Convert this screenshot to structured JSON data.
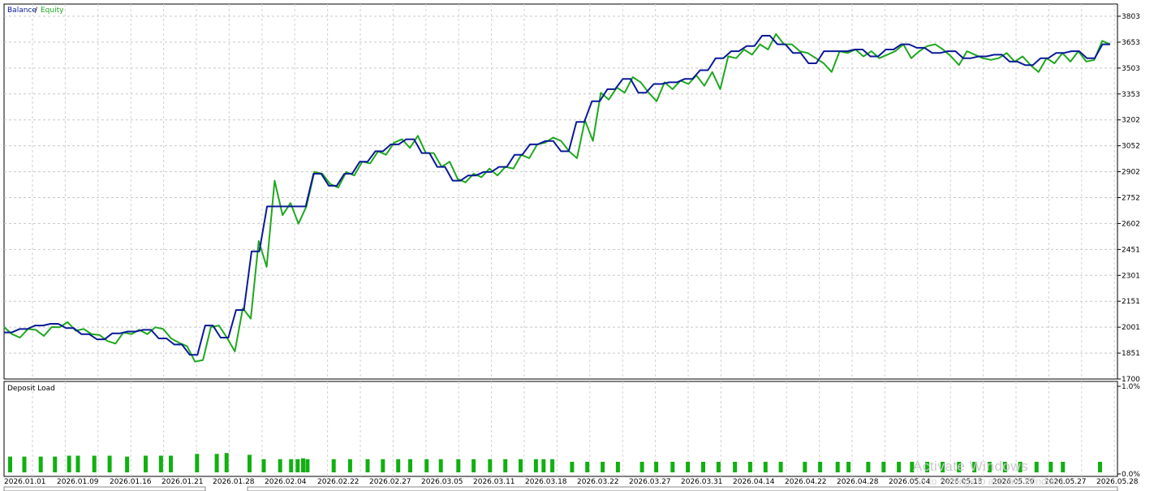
{
  "chart_data": [
    {
      "type": "line",
      "legend": [
        "Balance",
        "/",
        "Equity"
      ],
      "colors": {
        "balance": "#0a1a96",
        "equity": "#1fa81f",
        "separator": "#000000"
      },
      "y_ticks": [
        "3803",
        "3653",
        "3503",
        "3353",
        "3202",
        "3052",
        "2902",
        "2752",
        "2602",
        "2451",
        "2301",
        "2151",
        "2001",
        "1851",
        "1700"
      ],
      "ylim": [
        1700,
        3803
      ],
      "x_ticks": [
        "2026.01.01",
        "2026.01.09",
        "2026.01.16",
        "2026.01.21",
        "2026.01.28",
        "2026.02.04",
        "2026.02.22",
        "2026.02.27",
        "2026.03.05",
        "2026.03.11",
        "2026.03.18",
        "2026.03.22",
        "2026.03.27",
        "2026.03.31",
        "2026.04.14",
        "2026.04.22",
        "2026.04.28",
        "2026.05.04",
        "2026.05.13",
        "2026.05.20",
        "2026.05.27",
        "2026.05.28"
      ],
      "grid": true,
      "series": [
        {
          "name": "Balance",
          "values": [
            1970,
            1970,
            1990,
            1990,
            2010,
            2010,
            2020,
            2020,
            1995,
            1995,
            1960,
            1960,
            1930,
            1930,
            1965,
            1965,
            1975,
            1975,
            1985,
            1985,
            1935,
            1935,
            1900,
            1900,
            1840,
            1840,
            2010,
            2010,
            1940,
            1940,
            2100,
            2100,
            2440,
            2440,
            2700,
            2700,
            2700,
            2700,
            2700,
            2700,
            2890,
            2890,
            2820,
            2820,
            2890,
            2890,
            2960,
            2960,
            3020,
            3020,
            3060,
            3060,
            3090,
            3090,
            3010,
            3010,
            2930,
            2930,
            2850,
            2850,
            2880,
            2880,
            2900,
            2900,
            2930,
            2930,
            3000,
            3000,
            3060,
            3060,
            3080,
            3080,
            3020,
            3020,
            3190,
            3190,
            3310,
            3310,
            3380,
            3380,
            3440,
            3440,
            3360,
            3360,
            3410,
            3410,
            3420,
            3420,
            3440,
            3440,
            3490,
            3490,
            3560,
            3560,
            3600,
            3600,
            3630,
            3630,
            3690,
            3690,
            3640,
            3640,
            3590,
            3590,
            3530,
            3530,
            3600,
            3600,
            3600,
            3600,
            3610,
            3610,
            3570,
            3570,
            3610,
            3610,
            3640,
            3640,
            3620,
            3620,
            3590,
            3590,
            3600,
            3600,
            3560,
            3560,
            3570,
            3570,
            3580,
            3580,
            3540,
            3540,
            3520,
            3520,
            3560,
            3560,
            3590,
            3590,
            3600,
            3600,
            3560,
            3560,
            3640,
            3640
          ]
        },
        {
          "name": "Equity",
          "values": [
            2001,
            1960,
            1940,
            1990,
            1985,
            1950,
            2001,
            2000,
            2030,
            1980,
            1990,
            1960,
            1955,
            1920,
            1905,
            1970,
            1960,
            1985,
            1960,
            2000,
            1990,
            1935,
            1910,
            1890,
            1800,
            1810,
            2001,
            2010,
            1940,
            1860,
            2110,
            2050,
            2500,
            2350,
            2850,
            2650,
            2720,
            2600,
            2701,
            2900,
            2890,
            2830,
            2810,
            2900,
            2880,
            2960,
            2950,
            3020,
            3000,
            3070,
            3090,
            3040,
            3110,
            3010,
            3010,
            2930,
            2960,
            2860,
            2840,
            2890,
            2870,
            2920,
            2880,
            2930,
            2920,
            3000,
            2980,
            3060,
            3070,
            3100,
            3080,
            3020,
            2980,
            3200,
            3080,
            3360,
            3320,
            3390,
            3360,
            3450,
            3420,
            3360,
            3310,
            3420,
            3380,
            3430,
            3410,
            3460,
            3400,
            3480,
            3380,
            3570,
            3560,
            3610,
            3580,
            3640,
            3610,
            3700,
            3640,
            3640,
            3600,
            3590,
            3560,
            3530,
            3480,
            3600,
            3590,
            3610,
            3570,
            3600,
            3560,
            3580,
            3600,
            3640,
            3560,
            3600,
            3630,
            3640,
            3610,
            3570,
            3520,
            3600,
            3580,
            3560,
            3550,
            3560,
            3590,
            3540,
            3570,
            3520,
            3480,
            3560,
            3530,
            3590,
            3540,
            3600,
            3540,
            3550,
            3660,
            3640
          ]
        }
      ]
    },
    {
      "type": "bar",
      "label": "Deposit Load",
      "y_ticks": [
        "1.0%",
        "0.0%"
      ],
      "ylim": [
        0,
        1.0
      ],
      "color": "#11b011",
      "bars": [
        {
          "x": "2026.01.01",
          "pos": 0.0,
          "value": 0.18
        },
        {
          "x": "",
          "pos": 0.013,
          "value": 0.18
        },
        {
          "x": "",
          "pos": 0.028,
          "value": 0.18
        },
        {
          "x": "",
          "pos": 0.041,
          "value": 0.18
        },
        {
          "x": "2026.01.09",
          "pos": 0.054,
          "value": 0.19
        },
        {
          "x": "",
          "pos": 0.062,
          "value": 0.19
        },
        {
          "x": "",
          "pos": 0.077,
          "value": 0.19
        },
        {
          "x": "",
          "pos": 0.091,
          "value": 0.19
        },
        {
          "x": "2026.01.16",
          "pos": 0.107,
          "value": 0.18
        },
        {
          "x": "",
          "pos": 0.124,
          "value": 0.19
        },
        {
          "x": "",
          "pos": 0.138,
          "value": 0.19
        },
        {
          "x": "",
          "pos": 0.147,
          "value": 0.19
        },
        {
          "x": "2026.01.21",
          "pos": 0.171,
          "value": 0.21
        },
        {
          "x": "",
          "pos": 0.189,
          "value": 0.21
        },
        {
          "x": "",
          "pos": 0.198,
          "value": 0.22
        },
        {
          "x": "2026.01.28",
          "pos": 0.219,
          "value": 0.2
        },
        {
          "x": "",
          "pos": 0.232,
          "value": 0.15
        },
        {
          "x": "",
          "pos": 0.247,
          "value": 0.15
        },
        {
          "x": "",
          "pos": 0.257,
          "value": 0.15
        },
        {
          "x": "2026.02.04",
          "pos": 0.263,
          "value": 0.15
        },
        {
          "x": "",
          "pos": 0.268,
          "value": 0.16
        },
        {
          "x": "",
          "pos": 0.272,
          "value": 0.15
        },
        {
          "x": "2026.02.22",
          "pos": 0.296,
          "value": 0.15
        },
        {
          "x": "",
          "pos": 0.311,
          "value": 0.15
        },
        {
          "x": "",
          "pos": 0.327,
          "value": 0.15
        },
        {
          "x": "",
          "pos": 0.341,
          "value": 0.15
        },
        {
          "x": "2026.02.27",
          "pos": 0.355,
          "value": 0.15
        },
        {
          "x": "",
          "pos": 0.366,
          "value": 0.15
        },
        {
          "x": "",
          "pos": 0.381,
          "value": 0.15
        },
        {
          "x": "2026.03.05",
          "pos": 0.394,
          "value": 0.15
        },
        {
          "x": "",
          "pos": 0.41,
          "value": 0.15
        },
        {
          "x": "",
          "pos": 0.424,
          "value": 0.15
        },
        {
          "x": "2026.03.11",
          "pos": 0.439,
          "value": 0.15
        },
        {
          "x": "",
          "pos": 0.453,
          "value": 0.15
        },
        {
          "x": "",
          "pos": 0.467,
          "value": 0.15
        },
        {
          "x": "2026.03.18",
          "pos": 0.481,
          "value": 0.15
        },
        {
          "x": "",
          "pos": 0.488,
          "value": 0.15
        },
        {
          "x": "",
          "pos": 0.496,
          "value": 0.15
        },
        {
          "x": "2026.03.22",
          "pos": 0.514,
          "value": 0.12
        },
        {
          "x": "",
          "pos": 0.528,
          "value": 0.12
        },
        {
          "x": "",
          "pos": 0.542,
          "value": 0.12
        },
        {
          "x": "",
          "pos": 0.556,
          "value": 0.12
        },
        {
          "x": "2026.03.27",
          "pos": 0.578,
          "value": 0.12
        },
        {
          "x": "",
          "pos": 0.591,
          "value": 0.12
        },
        {
          "x": "",
          "pos": 0.606,
          "value": 0.12
        },
        {
          "x": "2026.03.31",
          "pos": 0.62,
          "value": 0.12
        },
        {
          "x": "",
          "pos": 0.634,
          "value": 0.12
        },
        {
          "x": "",
          "pos": 0.648,
          "value": 0.12
        },
        {
          "x": "2026.04.14",
          "pos": 0.663,
          "value": 0.12
        },
        {
          "x": "",
          "pos": 0.677,
          "value": 0.12
        },
        {
          "x": "",
          "pos": 0.691,
          "value": 0.12
        },
        {
          "x": "",
          "pos": 0.705,
          "value": 0.12
        },
        {
          "x": "2026.04.22",
          "pos": 0.727,
          "value": 0.12
        },
        {
          "x": "",
          "pos": 0.741,
          "value": 0.12
        },
        {
          "x": "",
          "pos": 0.757,
          "value": 0.12
        },
        {
          "x": "2026.04.28",
          "pos": 0.767,
          "value": 0.12
        },
        {
          "x": "",
          "pos": 0.785,
          "value": 0.12
        },
        {
          "x": "",
          "pos": 0.799,
          "value": 0.12
        },
        {
          "x": "2026.05.04",
          "pos": 0.813,
          "value": 0.12
        },
        {
          "x": "",
          "pos": 0.825,
          "value": 0.12
        },
        {
          "x": "",
          "pos": 0.839,
          "value": 0.12
        },
        {
          "x": "2026.05.13",
          "pos": 0.853,
          "value": 0.12
        },
        {
          "x": "",
          "pos": 0.868,
          "value": 0.12
        },
        {
          "x": "",
          "pos": 0.882,
          "value": 0.12
        },
        {
          "x": "2026.05.20",
          "pos": 0.896,
          "value": 0.12
        },
        {
          "x": "",
          "pos": 0.91,
          "value": 0.12
        },
        {
          "x": "",
          "pos": 0.924,
          "value": 0.12
        },
        {
          "x": "2026.05.27",
          "pos": 0.939,
          "value": 0.12
        },
        {
          "x": "",
          "pos": 0.952,
          "value": 0.12
        },
        {
          "x": "",
          "pos": 0.963,
          "value": 0.12
        },
        {
          "x": "2026.05.28",
          "pos": 0.997,
          "value": 0.12
        }
      ]
    }
  ],
  "watermark": {
    "line1": "Activate Windows",
    "line2": "Go to Settings to activate Windows."
  }
}
